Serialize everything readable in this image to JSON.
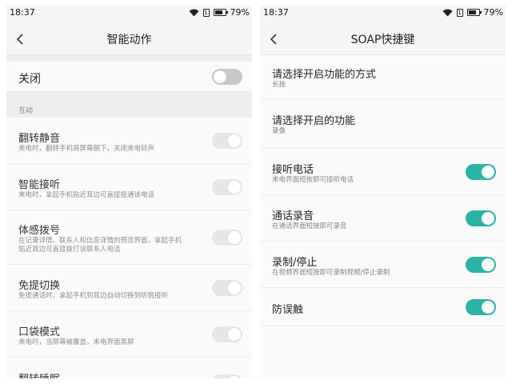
{
  "left": {
    "status": {
      "time": "18:37",
      "battery": "79%",
      "battery_level": 0.79,
      "sim_glyph": "1"
    },
    "nav": {
      "back_icon": "chevron-left-icon",
      "title": "智能动作"
    },
    "master": {
      "label": "关闭",
      "on": false
    },
    "section_header": "互动",
    "items": [
      {
        "title": "翻转静音",
        "desc": [
          "来电时，翻转手机将屏幕朝下，关闭来电铃声"
        ],
        "on": true,
        "enabled": false
      },
      {
        "title": "智能接听",
        "desc": [
          "来电时，拿起手机贴近耳边可直接接通该电话"
        ],
        "on": true,
        "enabled": false
      },
      {
        "title": "体感拨号",
        "desc": [
          "在记录详情、联系人和信息详情的预览界面，拿起手机",
          "贴近耳边可直接拨打该联系人电话"
        ],
        "on": true,
        "enabled": false
      },
      {
        "title": "免提切换",
        "desc": [
          "免提通话时，拿起手机到耳边自动切换到听筒接听"
        ],
        "on": true,
        "enabled": false
      },
      {
        "title": "口袋模式",
        "desc": [
          "来电时，当屏幕被覆盖，来电界面黑屏"
        ],
        "on": true,
        "enabled": false
      },
      {
        "title": "翻转睡眠",
        "desc": [],
        "on": true,
        "enabled": false
      }
    ]
  },
  "right": {
    "status": {
      "time": "18:37",
      "battery": "79%",
      "battery_level": 0.79,
      "sim_glyph": "1"
    },
    "nav": {
      "back_icon": "chevron-left-icon",
      "title": "SOAP快捷键"
    },
    "settings": [
      {
        "title": "请选择开启功能的方式",
        "value": "长按"
      },
      {
        "title": "请选择开启的功能",
        "value": "录像"
      }
    ],
    "items": [
      {
        "title": "接听电话",
        "desc": "来电界面短按即可接听电话",
        "on": true
      },
      {
        "title": "通话录音",
        "desc": "在通话界面短按即可录音",
        "on": true
      },
      {
        "title": "录制/停止",
        "desc": "在视频界面短按即可录制视频/停止录制",
        "on": true
      },
      {
        "title": "防误触",
        "desc": "",
        "on": true
      }
    ]
  },
  "colors": {
    "accent": "#2bb3a6",
    "toggle_off": "#c8c8c8",
    "toggle_disabled": "#e6e6e6",
    "section_bg": "#ededed"
  }
}
